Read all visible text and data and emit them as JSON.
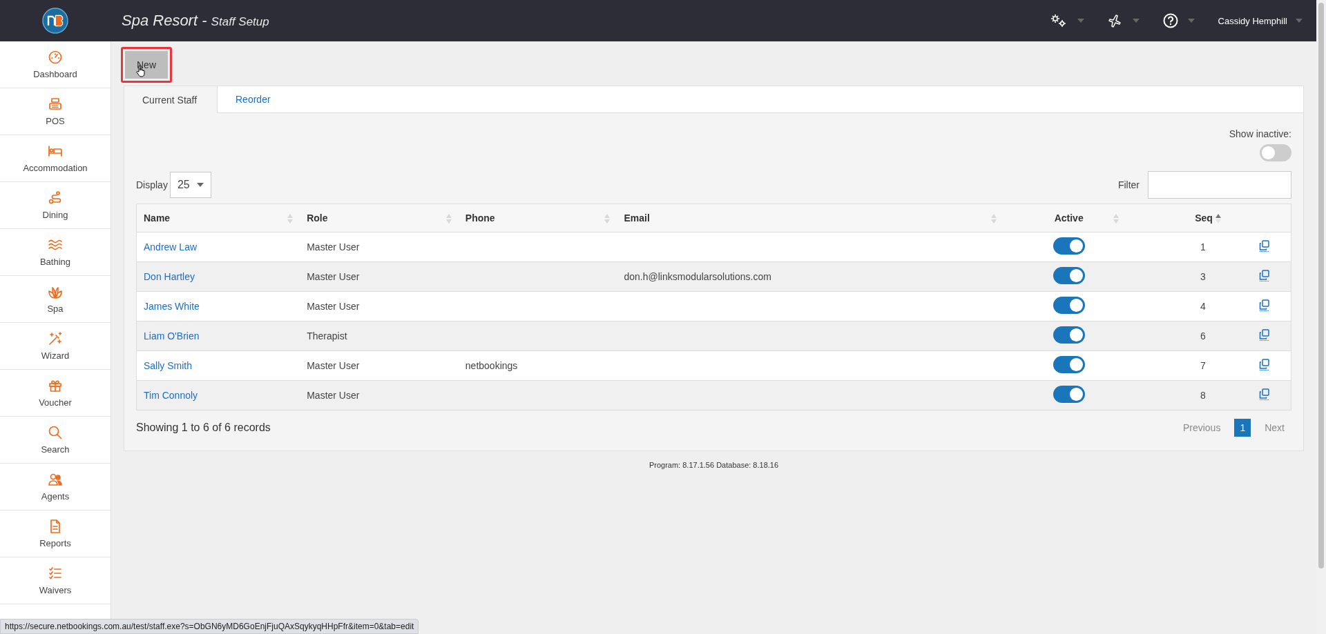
{
  "header": {
    "title": "Spa Resort",
    "separator": "-",
    "subtitle": "Staff Setup",
    "user": "Cassidy Hemphill"
  },
  "sidebar": {
    "items": [
      {
        "label": "Dashboard",
        "kind": "gauge"
      },
      {
        "label": "POS",
        "kind": "register"
      },
      {
        "label": "Accommodation",
        "kind": "bed"
      },
      {
        "label": "Dining",
        "kind": "route"
      },
      {
        "label": "Bathing",
        "kind": "waves"
      },
      {
        "label": "Spa",
        "kind": "lotus"
      },
      {
        "label": "Wizard",
        "kind": "wand"
      },
      {
        "label": "Voucher",
        "kind": "gift"
      },
      {
        "label": "Search",
        "kind": "search"
      },
      {
        "label": "Agents",
        "kind": "people"
      },
      {
        "label": "Reports",
        "kind": "document"
      },
      {
        "label": "Waivers",
        "kind": "checklist"
      }
    ]
  },
  "new_button": {
    "label": "New",
    "highlighted": true
  },
  "tabs": [
    {
      "label": "Current Staff",
      "selected": true
    },
    {
      "label": "Reorder",
      "selected": false
    }
  ],
  "show_inactive": {
    "label": "Show inactive:",
    "on": false
  },
  "display": {
    "label": "Display",
    "value": "25"
  },
  "filter": {
    "label": "Filter"
  },
  "table": {
    "columns": [
      {
        "label": "Name",
        "sorted": false
      },
      {
        "label": "Role",
        "sorted": false
      },
      {
        "label": "Phone",
        "sorted": false
      },
      {
        "label": "Email",
        "sorted": false
      },
      {
        "label": "Active",
        "sorted": false
      },
      {
        "label": "Seq",
        "sorted": true
      }
    ],
    "rows": [
      {
        "name": "Andrew Law",
        "role": "Master User",
        "active": true,
        "seq": "1"
      },
      {
        "name": "Don Hartley",
        "role": "Master User",
        "email": "don.h@linksmodularsolutions.com",
        "active": true,
        "seq": "3"
      },
      {
        "name": "James White",
        "role": "Master User",
        "active": true,
        "seq": "4"
      },
      {
        "name": "Liam O'Brien",
        "role": "Therapist",
        "active": true,
        "seq": "6"
      },
      {
        "name": "Sally Smith",
        "role": "Master User",
        "phone": "netbookings",
        "active": true,
        "seq": "7"
      },
      {
        "name": "Tim Connoly",
        "role": "Master User",
        "active": true,
        "seq": "8"
      }
    ]
  },
  "summary": "Showing 1 to 6 of 6 records",
  "pagination": {
    "previous": "Previous",
    "pages": [
      {
        "label": "1",
        "selected": true
      }
    ],
    "next": "Next"
  },
  "footer": "Program: 8.17.1.56 Database: 8.18.16",
  "status_bar": "https://secure.netbookings.com.au/test/staff.exe?s=ObGN6yMD6GoEnjFjuQAxSqykyqHHpFfr&item=0&tab=edit"
}
